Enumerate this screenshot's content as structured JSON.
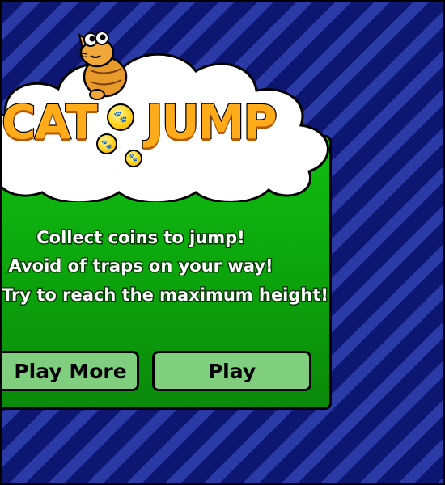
{
  "game": {
    "title_part1": "CAT",
    "title_part2": "JUMP",
    "instructions": [
      "Collect coins to jump!",
      "Avoid of traps on your way!",
      "Try to reach the maximum height!"
    ],
    "buttons": {
      "play_more": "Play More",
      "play": "Play"
    }
  },
  "colors": {
    "background": "#0d1670",
    "panel": "#0fbf0f",
    "title": "#ffab1a",
    "coin": "#ffd21a",
    "button": "#7fcf7f"
  },
  "icons": [
    "cat-mascot-icon",
    "paw-coin-icon",
    "coin-icon"
  ]
}
